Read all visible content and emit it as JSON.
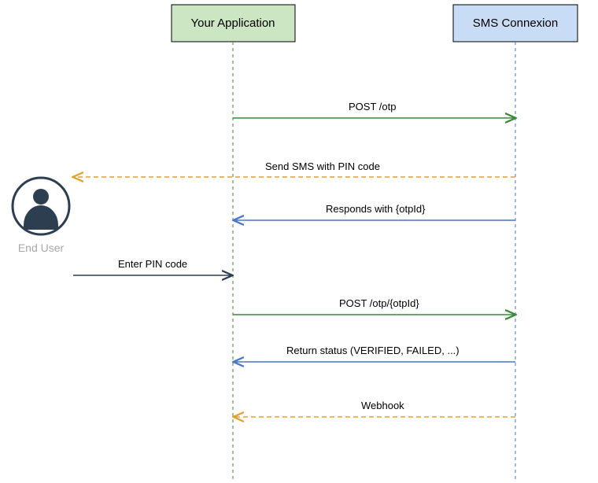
{
  "actor": {
    "label": "End User"
  },
  "participants": {
    "app": {
      "label": "Your Application",
      "color_fill": "#cce6c4"
    },
    "sms": {
      "label": "SMS Connexion",
      "color_fill": "#c9dcf6"
    }
  },
  "messages": {
    "m1": {
      "label": "POST /otp"
    },
    "m2": {
      "label": "Send SMS with PIN code"
    },
    "m3": {
      "label": "Responds with {otpId}"
    },
    "m4": {
      "label": "Enter PIN code"
    },
    "m5": {
      "label": "POST /otp/{otpId}"
    },
    "m6": {
      "label": "Return status (VERIFIED, FAILED, ...)"
    },
    "m7": {
      "label": "Webhook"
    }
  },
  "chart_data": {
    "type": "sequence-diagram",
    "actors": [
      "End User",
      "Your Application",
      "SMS Connexion"
    ],
    "messages": [
      {
        "from": "Your Application",
        "to": "SMS Connexion",
        "label": "POST /otp",
        "style": "solid"
      },
      {
        "from": "SMS Connexion",
        "to": "End User",
        "label": "Send SMS with PIN code",
        "style": "dashed"
      },
      {
        "from": "SMS Connexion",
        "to": "Your Application",
        "label": "Responds with {otpId}",
        "style": "solid"
      },
      {
        "from": "End User",
        "to": "Your Application",
        "label": "Enter PIN code",
        "style": "solid"
      },
      {
        "from": "Your Application",
        "to": "SMS Connexion",
        "label": "POST /otp/{otpId}",
        "style": "solid"
      },
      {
        "from": "SMS Connexion",
        "to": "Your Application",
        "label": "Return status (VERIFIED, FAILED, ...)",
        "style": "solid"
      },
      {
        "from": "SMS Connexion",
        "to": "Your Application",
        "label": "Webhook",
        "style": "dashed"
      }
    ]
  }
}
